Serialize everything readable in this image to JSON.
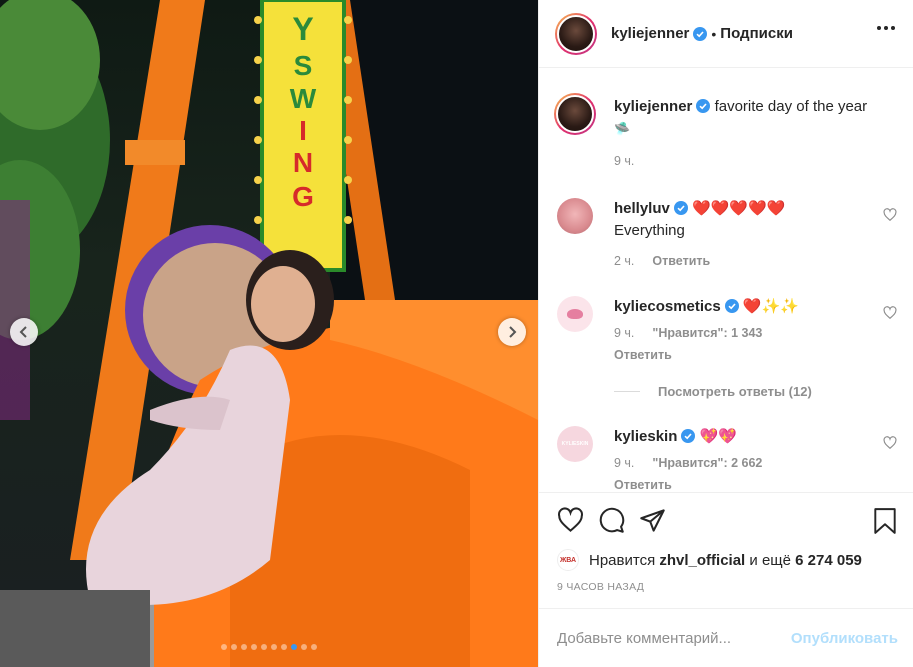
{
  "post": {
    "sign_text": "Y SWING",
    "carousel": {
      "total_slides": 10,
      "active_slide": 8
    }
  },
  "header": {
    "username": "kyliejenner",
    "follow_state": "Подписки",
    "separator": "•"
  },
  "caption": {
    "username": "kyliejenner",
    "text": "favorite day of the year",
    "emoji": "🛸",
    "time": "9 ч."
  },
  "comments": [
    {
      "username": "hellyluv",
      "text": "Everything",
      "emoji": "❤️❤️❤️❤️❤️",
      "time": "2 ч.",
      "reply": "Ответить"
    },
    {
      "username": "kyliecosmetics",
      "emoji": "❤️✨✨",
      "time": "9 ч.",
      "likes": "\"Нравится\": 1 343",
      "reply": "Ответить"
    },
    {
      "username": "kylieskin",
      "emoji": "💖💖",
      "time": "9 ч.",
      "likes": "\"Нравится\": 2 662",
      "reply": "Ответить",
      "avatar_text": "KYLIESKIN"
    }
  ],
  "view_replies": "Посмотреть ответы (12)",
  "likes": {
    "prefix": "Нравится",
    "user": "zhvl_official",
    "mid": "и ещё",
    "count": "6 274 059",
    "mini_avatar_text": "ЖВА"
  },
  "time_ago": "9 ЧАСОВ НАЗАД",
  "add_comment": {
    "placeholder": "Добавьте комментарий...",
    "post_label": "Опубликовать"
  },
  "colors": {
    "accent": "#3897f0",
    "verified": "#3897f0",
    "post_disabled": "#b2dffc",
    "heart_red": "#ed4956"
  }
}
